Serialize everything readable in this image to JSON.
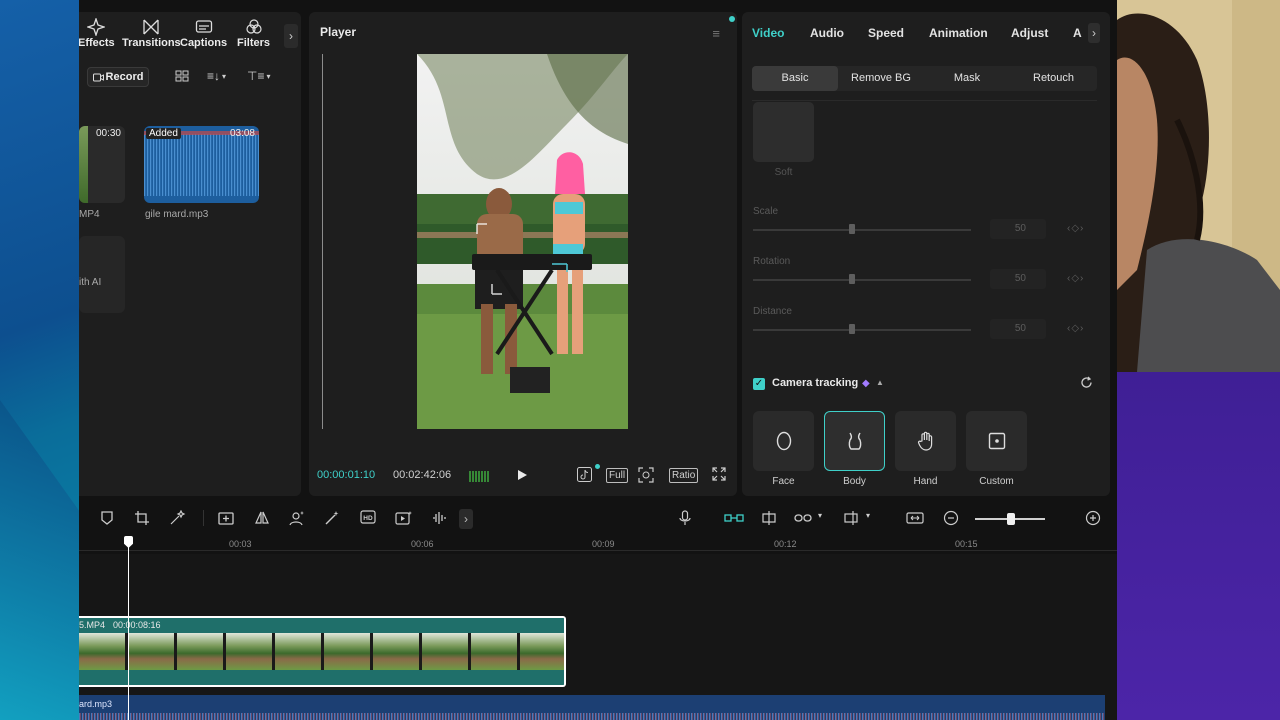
{
  "media_tabs": [
    {
      "label": "Effects",
      "icon": "sparkle-icon"
    },
    {
      "label": "Transitions",
      "icon": "transition-icon"
    },
    {
      "label": "Captions",
      "icon": "captions-icon"
    },
    {
      "label": "Filters",
      "icon": "filters-icon"
    }
  ],
  "media": {
    "record_label": "Record",
    "clip1": {
      "duration": "00:30",
      "name": "MP4"
    },
    "clip2": {
      "badge": "Added",
      "duration": "03:08",
      "name": "gile mard.mp3"
    },
    "ai_label": "ith AI"
  },
  "player": {
    "title": "Player",
    "current_time": "00:00:01:10",
    "total_time": "00:02:42:06",
    "full_label": "Full",
    "ratio_label": "Ratio"
  },
  "props": {
    "tabs": [
      "Video",
      "Audio",
      "Speed",
      "Animation",
      "Adjust",
      "A"
    ],
    "subtabs": [
      "Basic",
      "Remove BG",
      "Mask",
      "Retouch"
    ],
    "soft_label": "Soft",
    "params": [
      {
        "label": "Scale",
        "value": "50"
      },
      {
        "label": "Rotation",
        "value": "50"
      },
      {
        "label": "Distance",
        "value": "50"
      }
    ],
    "camera_tracking": "Camera tracking",
    "tracking_modes": [
      "Face",
      "Body",
      "Hand",
      "Custom"
    ]
  },
  "timeline": {
    "ticks": [
      "00:03",
      "00:06",
      "00:09",
      "00:12",
      "00:15"
    ],
    "video_clip_label": "5.MP4",
    "video_clip_duration": "00:00:08:16",
    "audio_clip_label": "ard.mp3"
  },
  "colors": {
    "accent": "#3fd0c9",
    "clip": "#1f6f6a",
    "audio": "#1c3f73"
  }
}
